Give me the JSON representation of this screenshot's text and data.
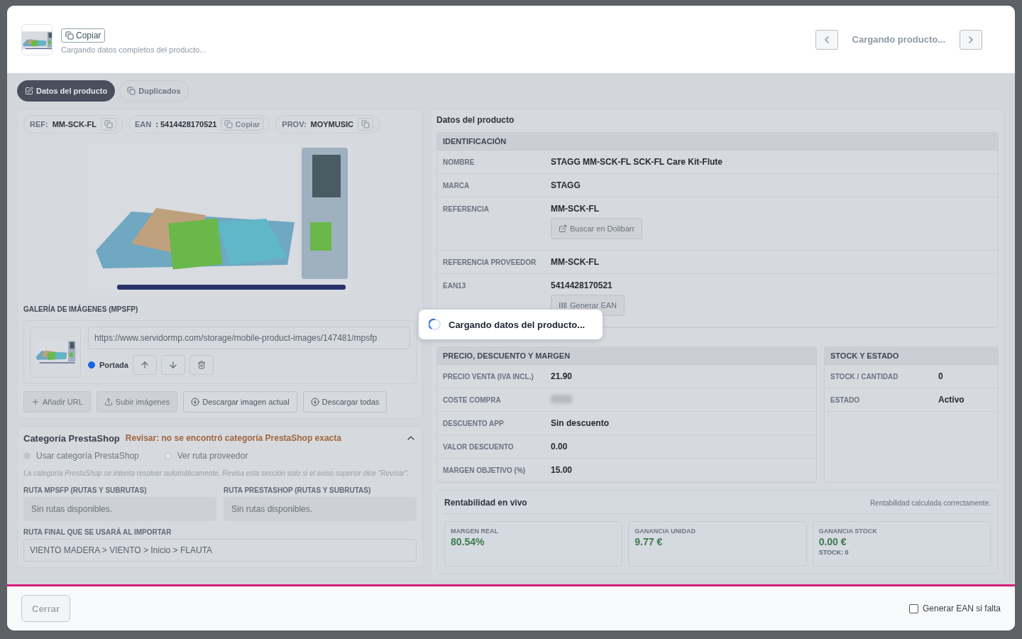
{
  "header": {
    "copy_button": "Copiar",
    "subtitle": "Cargando datos completos del producto...",
    "nav_label": "Cargando producto..."
  },
  "tabs": [
    {
      "label": "Datos del producto",
      "selected": true
    },
    {
      "label": "Duplicados",
      "selected": false
    }
  ],
  "chips": [
    {
      "label": "REF:",
      "value": "MM-SCK-FL"
    },
    {
      "label": "EAN",
      "value": ": 5414428170521",
      "copy": "Copiar"
    },
    {
      "label": "PROV:",
      "value": "MOYMUSIC"
    }
  ],
  "gallery": {
    "title": "GALERÍA DE IMÁGENES (MPSFP)",
    "url": "https://www.servidormp.com/storage/mobile-product-images/147481/mpsfp",
    "cover_label": "Portada",
    "cover_selected": true,
    "actions": [
      {
        "label": "Añadir URL",
        "disabled": true
      },
      {
        "label": "Subir imágenes",
        "disabled": true
      },
      {
        "label": "Descargar imagen actual",
        "disabled": false
      },
      {
        "label": "Descargar todas",
        "disabled": false
      }
    ]
  },
  "category": {
    "title": "Categoría PrestaShop",
    "warning": "Revisar: no se encontró categoría PrestaShop exacta",
    "expanded": true,
    "options": [
      {
        "label": "Usar categoría PrestaShop",
        "selected": true
      },
      {
        "label": "Ver ruta proveedor",
        "selected": false
      }
    ],
    "note": "La categoría PrestaShop se intenta resolver automáticamente. Revisa esta sección solo si el aviso superior dice \"Revisar\".",
    "routes": [
      {
        "label": "RUTA MPSFP (RUTAS Y SUBRUTAS)",
        "placeholder": "Sin rutas disponibles."
      },
      {
        "label": "RUTA PRESTASHOP (RUTAS Y SUBRUTAS)",
        "placeholder": "Sin rutas disponibles."
      }
    ],
    "final_label": "RUTA FINAL QUE SE USARÁ AL IMPORTAR",
    "final_value": "VIENTO MADERA > VIENTO > Inicio > FLAUTA"
  },
  "product": {
    "title": "Datos del producto",
    "identification": {
      "title": "IDENTIFICACIÓN",
      "rows": [
        {
          "label": "NOMBRE",
          "value": "STAGG MM-SCK-FL SCK-FL Care Kit-Flute"
        },
        {
          "label": "MARCA",
          "value": "STAGG"
        },
        {
          "label": "REFERENCIA",
          "value": "MM-SCK-FL",
          "button": "Buscar en Dolibarr"
        },
        {
          "label": "REFERENCIA PROVEEDOR",
          "value": "MM-SCK-FL"
        },
        {
          "label": "EAN13",
          "value": "5414428170521",
          "button": "Generar EAN"
        }
      ]
    },
    "price": {
      "title": "PRECIO, DESCUENTO Y MARGEN",
      "rows": [
        {
          "label": "PRECIO VENTA (IVA INCL.)",
          "value": "21.90",
          "kind": "text"
        },
        {
          "label": "COSTE COMPRA",
          "kind": "hidden"
        },
        {
          "label": "DESCUENTO APP",
          "value": "Sin descuento",
          "kind": "text"
        },
        {
          "label": "VALOR DESCUENTO",
          "value": "0.00",
          "kind": "text"
        },
        {
          "label": "MARGEN OBJETIVO (%)",
          "value": "15.00",
          "kind": "text"
        }
      ]
    },
    "stock": {
      "title": "STOCK Y ESTADO",
      "rows": [
        {
          "label": "STOCK / CANTIDAD",
          "value": "0"
        },
        {
          "label": "ESTADO",
          "value": "Activo"
        }
      ]
    },
    "profit": {
      "title": "Rentabilidad en vivo",
      "status": "Rentabilidad calculada correctamente.",
      "cards": [
        {
          "label": "MARGEN REAL",
          "value": "80.54%"
        },
        {
          "label": "GANANCIA UNIDAD",
          "value": "9.77 €"
        },
        {
          "label": "GANANCIA STOCK",
          "value": "0.00 €",
          "sub": "STOCK: 0"
        }
      ]
    }
  },
  "loading": {
    "text": "Cargando datos del producto..."
  },
  "footer": {
    "close": "Cerrar",
    "ean_option": {
      "label": "Generar EAN si falta",
      "checked": false
    }
  }
}
